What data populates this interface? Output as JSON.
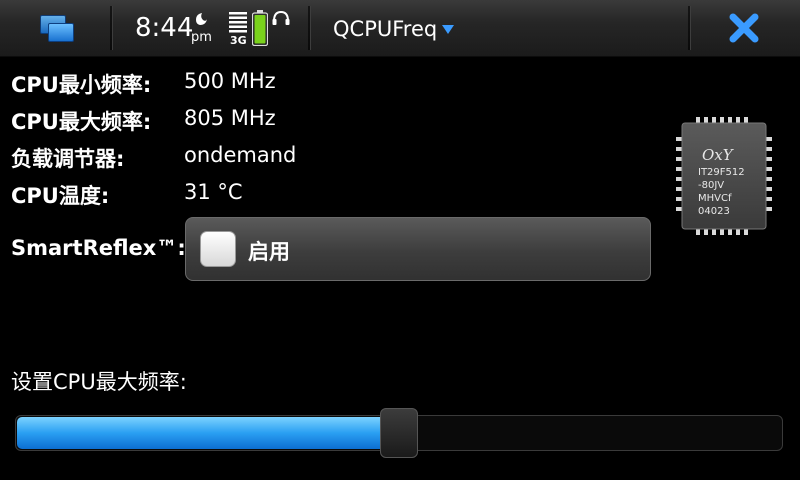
{
  "status_bar": {
    "time": "8:44",
    "ampm": "pm",
    "network": "3G",
    "app_title": "QCPUFreq"
  },
  "info": [
    {
      "label": "CPU最小频率:",
      "value": "500 MHz"
    },
    {
      "label": "CPU最大频率:",
      "value": "805 MHz"
    },
    {
      "label": "负载调节器:",
      "value": "ondemand"
    },
    {
      "label": "CPU温度:",
      "value": "31 °C"
    }
  ],
  "smartreflex": {
    "label": "SmartReflex™:",
    "option_label": "启用",
    "checked": false
  },
  "chip": {
    "brand": "OxY",
    "lines": [
      "IT29F512",
      "-80JV",
      "MHVCf",
      "04023"
    ]
  },
  "slider": {
    "title": "设置CPU最大频率:",
    "fraction": 0.5
  },
  "colors": {
    "accent": "#2a9ff2",
    "close": "#3a9bff"
  },
  "icons": [
    "task-switcher-icon",
    "alarm-icon",
    "signal-icon",
    "battery-icon",
    "headset-icon",
    "menu-arrow-icon",
    "close-icon"
  ]
}
